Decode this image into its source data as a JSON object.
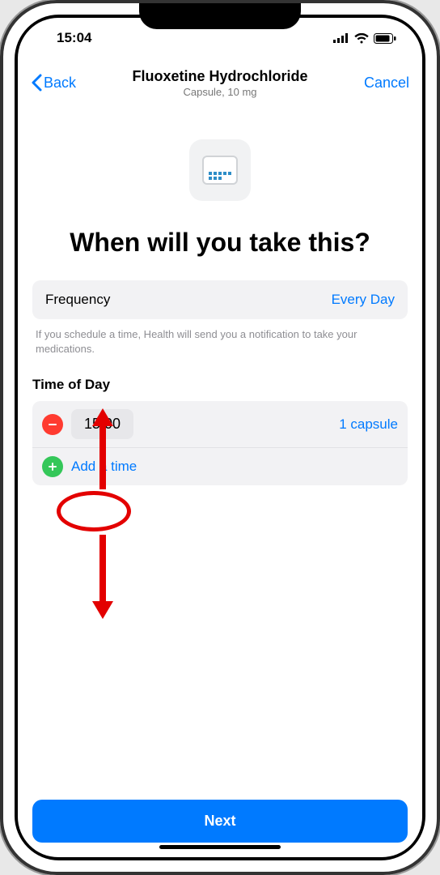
{
  "status": {
    "time": "15:04"
  },
  "nav": {
    "back_label": "Back",
    "title": "Fluoxetine Hydrochloride",
    "subtitle": "Capsule, 10 mg",
    "cancel_label": "Cancel"
  },
  "heading": "When will you take this?",
  "frequency": {
    "label": "Frequency",
    "value": "Every Day"
  },
  "hint": "If you schedule a time, Health will send you a notification to take your medications.",
  "time_section_title": "Time of Day",
  "times": [
    {
      "time": "15:00",
      "dose": "1 capsule"
    }
  ],
  "add_time_label": "Add a time",
  "next_label": "Next",
  "annotation": {
    "highlighted_time_index": 0
  }
}
